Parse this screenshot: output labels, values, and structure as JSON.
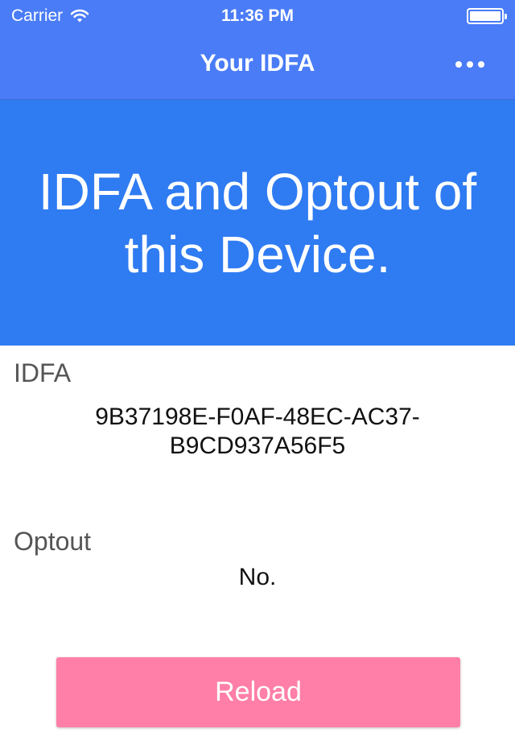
{
  "status_bar": {
    "carrier": "Carrier",
    "time": "11:36 PM",
    "wifi_icon": "wifi-icon",
    "battery_icon": "battery-icon",
    "battery_level": 1.0
  },
  "nav": {
    "title": "Your IDFA",
    "more_icon": "more-horizontal-icon"
  },
  "hero": {
    "heading": "IDFA and Optout of this Device."
  },
  "idfa": {
    "label": "IDFA",
    "value": "9B37198E-F0AF-48EC-AC37-B9CD937A56F5"
  },
  "optout": {
    "label": "Optout",
    "value": "No."
  },
  "actions": {
    "reload_label": "Reload"
  },
  "colors": {
    "nav_bar": "#4a7cf7",
    "hero": "#2f7bf2",
    "reload_button": "#ff7fa8"
  }
}
